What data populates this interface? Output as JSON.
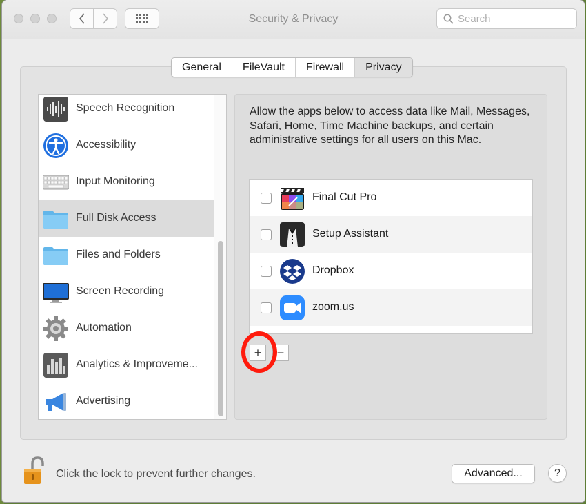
{
  "window": {
    "title": "Security & Privacy",
    "search_placeholder": "Search"
  },
  "tabs": [
    {
      "label": "General",
      "active": false
    },
    {
      "label": "FileVault",
      "active": false
    },
    {
      "label": "Firewall",
      "active": false
    },
    {
      "label": "Privacy",
      "active": true
    }
  ],
  "sidebar": {
    "items": [
      {
        "label": "Speech Recognition",
        "icon": "waveform-icon",
        "selected": false
      },
      {
        "label": "Accessibility",
        "icon": "accessibility-icon",
        "selected": false
      },
      {
        "label": "Input Monitoring",
        "icon": "keyboard-icon",
        "selected": false
      },
      {
        "label": "Full Disk Access",
        "icon": "folder-icon",
        "selected": true
      },
      {
        "label": "Files and Folders",
        "icon": "folder-icon",
        "selected": false
      },
      {
        "label": "Screen Recording",
        "icon": "display-icon",
        "selected": false
      },
      {
        "label": "Automation",
        "icon": "gear-icon",
        "selected": false
      },
      {
        "label": "Analytics & Improveme...",
        "icon": "bar-chart-icon",
        "selected": false
      },
      {
        "label": "Advertising",
        "icon": "megaphone-icon",
        "selected": false
      }
    ]
  },
  "main": {
    "description": "Allow the apps below to access data like Mail, Messages, Safari, Home, Time Machine backups, and certain administrative settings for all users on this Mac.",
    "apps": [
      {
        "name": "Final Cut Pro",
        "checked": false,
        "icon": "final-cut-pro-icon"
      },
      {
        "name": "Setup Assistant",
        "checked": false,
        "icon": "setup-assistant-icon"
      },
      {
        "name": "Dropbox",
        "checked": false,
        "icon": "dropbox-icon"
      },
      {
        "name": "zoom.us",
        "checked": false,
        "icon": "zoom-icon"
      }
    ],
    "add_label": "+",
    "remove_label": "−"
  },
  "footer": {
    "lock_text": "Click the lock to prevent further changes.",
    "advanced_label": "Advanced...",
    "help_label": "?"
  },
  "colors": {
    "selection": "#dcdcdc",
    "highlight_ring": "#ff1b0d"
  }
}
